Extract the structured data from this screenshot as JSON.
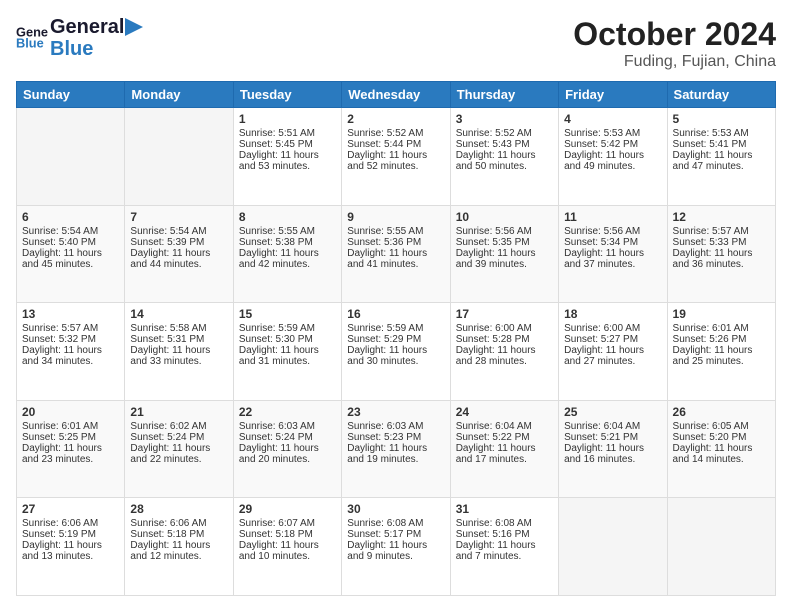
{
  "header": {
    "logo_line1": "General",
    "logo_line2": "Blue",
    "month_title": "October 2024",
    "location": "Fuding, Fujian, China"
  },
  "days_of_week": [
    "Sunday",
    "Monday",
    "Tuesday",
    "Wednesday",
    "Thursday",
    "Friday",
    "Saturday"
  ],
  "weeks": [
    [
      {
        "day": "",
        "empty": true
      },
      {
        "day": "",
        "empty": true
      },
      {
        "day": "1",
        "sunrise": "Sunrise: 5:51 AM",
        "sunset": "Sunset: 5:45 PM",
        "daylight": "Daylight: 11 hours and 53 minutes."
      },
      {
        "day": "2",
        "sunrise": "Sunrise: 5:52 AM",
        "sunset": "Sunset: 5:44 PM",
        "daylight": "Daylight: 11 hours and 52 minutes."
      },
      {
        "day": "3",
        "sunrise": "Sunrise: 5:52 AM",
        "sunset": "Sunset: 5:43 PM",
        "daylight": "Daylight: 11 hours and 50 minutes."
      },
      {
        "day": "4",
        "sunrise": "Sunrise: 5:53 AM",
        "sunset": "Sunset: 5:42 PM",
        "daylight": "Daylight: 11 hours and 49 minutes."
      },
      {
        "day": "5",
        "sunrise": "Sunrise: 5:53 AM",
        "sunset": "Sunset: 5:41 PM",
        "daylight": "Daylight: 11 hours and 47 minutes."
      }
    ],
    [
      {
        "day": "6",
        "sunrise": "Sunrise: 5:54 AM",
        "sunset": "Sunset: 5:40 PM",
        "daylight": "Daylight: 11 hours and 45 minutes."
      },
      {
        "day": "7",
        "sunrise": "Sunrise: 5:54 AM",
        "sunset": "Sunset: 5:39 PM",
        "daylight": "Daylight: 11 hours and 44 minutes."
      },
      {
        "day": "8",
        "sunrise": "Sunrise: 5:55 AM",
        "sunset": "Sunset: 5:38 PM",
        "daylight": "Daylight: 11 hours and 42 minutes."
      },
      {
        "day": "9",
        "sunrise": "Sunrise: 5:55 AM",
        "sunset": "Sunset: 5:36 PM",
        "daylight": "Daylight: 11 hours and 41 minutes."
      },
      {
        "day": "10",
        "sunrise": "Sunrise: 5:56 AM",
        "sunset": "Sunset: 5:35 PM",
        "daylight": "Daylight: 11 hours and 39 minutes."
      },
      {
        "day": "11",
        "sunrise": "Sunrise: 5:56 AM",
        "sunset": "Sunset: 5:34 PM",
        "daylight": "Daylight: 11 hours and 37 minutes."
      },
      {
        "day": "12",
        "sunrise": "Sunrise: 5:57 AM",
        "sunset": "Sunset: 5:33 PM",
        "daylight": "Daylight: 11 hours and 36 minutes."
      }
    ],
    [
      {
        "day": "13",
        "sunrise": "Sunrise: 5:57 AM",
        "sunset": "Sunset: 5:32 PM",
        "daylight": "Daylight: 11 hours and 34 minutes."
      },
      {
        "day": "14",
        "sunrise": "Sunrise: 5:58 AM",
        "sunset": "Sunset: 5:31 PM",
        "daylight": "Daylight: 11 hours and 33 minutes."
      },
      {
        "day": "15",
        "sunrise": "Sunrise: 5:59 AM",
        "sunset": "Sunset: 5:30 PM",
        "daylight": "Daylight: 11 hours and 31 minutes."
      },
      {
        "day": "16",
        "sunrise": "Sunrise: 5:59 AM",
        "sunset": "Sunset: 5:29 PM",
        "daylight": "Daylight: 11 hours and 30 minutes."
      },
      {
        "day": "17",
        "sunrise": "Sunrise: 6:00 AM",
        "sunset": "Sunset: 5:28 PM",
        "daylight": "Daylight: 11 hours and 28 minutes."
      },
      {
        "day": "18",
        "sunrise": "Sunrise: 6:00 AM",
        "sunset": "Sunset: 5:27 PM",
        "daylight": "Daylight: 11 hours and 27 minutes."
      },
      {
        "day": "19",
        "sunrise": "Sunrise: 6:01 AM",
        "sunset": "Sunset: 5:26 PM",
        "daylight": "Daylight: 11 hours and 25 minutes."
      }
    ],
    [
      {
        "day": "20",
        "sunrise": "Sunrise: 6:01 AM",
        "sunset": "Sunset: 5:25 PM",
        "daylight": "Daylight: 11 hours and 23 minutes."
      },
      {
        "day": "21",
        "sunrise": "Sunrise: 6:02 AM",
        "sunset": "Sunset: 5:24 PM",
        "daylight": "Daylight: 11 hours and 22 minutes."
      },
      {
        "day": "22",
        "sunrise": "Sunrise: 6:03 AM",
        "sunset": "Sunset: 5:24 PM",
        "daylight": "Daylight: 11 hours and 20 minutes."
      },
      {
        "day": "23",
        "sunrise": "Sunrise: 6:03 AM",
        "sunset": "Sunset: 5:23 PM",
        "daylight": "Daylight: 11 hours and 19 minutes."
      },
      {
        "day": "24",
        "sunrise": "Sunrise: 6:04 AM",
        "sunset": "Sunset: 5:22 PM",
        "daylight": "Daylight: 11 hours and 17 minutes."
      },
      {
        "day": "25",
        "sunrise": "Sunrise: 6:04 AM",
        "sunset": "Sunset: 5:21 PM",
        "daylight": "Daylight: 11 hours and 16 minutes."
      },
      {
        "day": "26",
        "sunrise": "Sunrise: 6:05 AM",
        "sunset": "Sunset: 5:20 PM",
        "daylight": "Daylight: 11 hours and 14 minutes."
      }
    ],
    [
      {
        "day": "27",
        "sunrise": "Sunrise: 6:06 AM",
        "sunset": "Sunset: 5:19 PM",
        "daylight": "Daylight: 11 hours and 13 minutes."
      },
      {
        "day": "28",
        "sunrise": "Sunrise: 6:06 AM",
        "sunset": "Sunset: 5:18 PM",
        "daylight": "Daylight: 11 hours and 12 minutes."
      },
      {
        "day": "29",
        "sunrise": "Sunrise: 6:07 AM",
        "sunset": "Sunset: 5:18 PM",
        "daylight": "Daylight: 11 hours and 10 minutes."
      },
      {
        "day": "30",
        "sunrise": "Sunrise: 6:08 AM",
        "sunset": "Sunset: 5:17 PM",
        "daylight": "Daylight: 11 hours and 9 minutes."
      },
      {
        "day": "31",
        "sunrise": "Sunrise: 6:08 AM",
        "sunset": "Sunset: 5:16 PM",
        "daylight": "Daylight: 11 hours and 7 minutes."
      },
      {
        "day": "",
        "empty": true
      },
      {
        "day": "",
        "empty": true
      }
    ]
  ]
}
